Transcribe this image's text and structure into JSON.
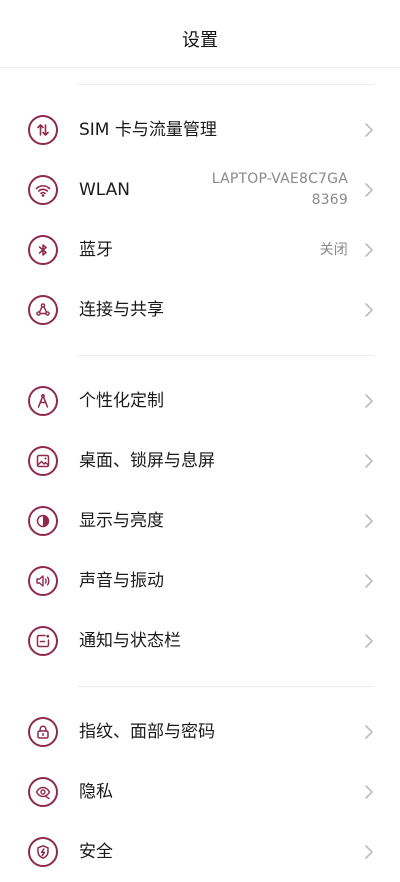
{
  "header": {
    "title": "设置"
  },
  "accent_color": "#8f2a4c",
  "rows": [
    {
      "label": "SIM 卡与流量管理",
      "icon": "sim-data-icon"
    },
    {
      "label": "WLAN",
      "icon": "wifi-icon",
      "value_line1": "LAPTOP-VAE8C7GA",
      "value_line2": "8369"
    },
    {
      "label": "蓝牙",
      "icon": "bluetooth-icon",
      "value_line1": "关闭"
    },
    {
      "label": "连接与共享",
      "icon": "share-connect-icon"
    },
    {
      "label": "个性化定制",
      "icon": "personalize-icon"
    },
    {
      "label": "桌面、锁屏与息屏",
      "icon": "wallpaper-icon"
    },
    {
      "label": "显示与亮度",
      "icon": "brightness-icon"
    },
    {
      "label": "声音与振动",
      "icon": "speaker-icon"
    },
    {
      "label": "通知与状态栏",
      "icon": "notification-icon"
    },
    {
      "label": "指纹、面部与密码",
      "icon": "lock-icon"
    },
    {
      "label": "隐私",
      "icon": "privacy-eye-icon"
    },
    {
      "label": "安全",
      "icon": "shield-icon"
    }
  ]
}
